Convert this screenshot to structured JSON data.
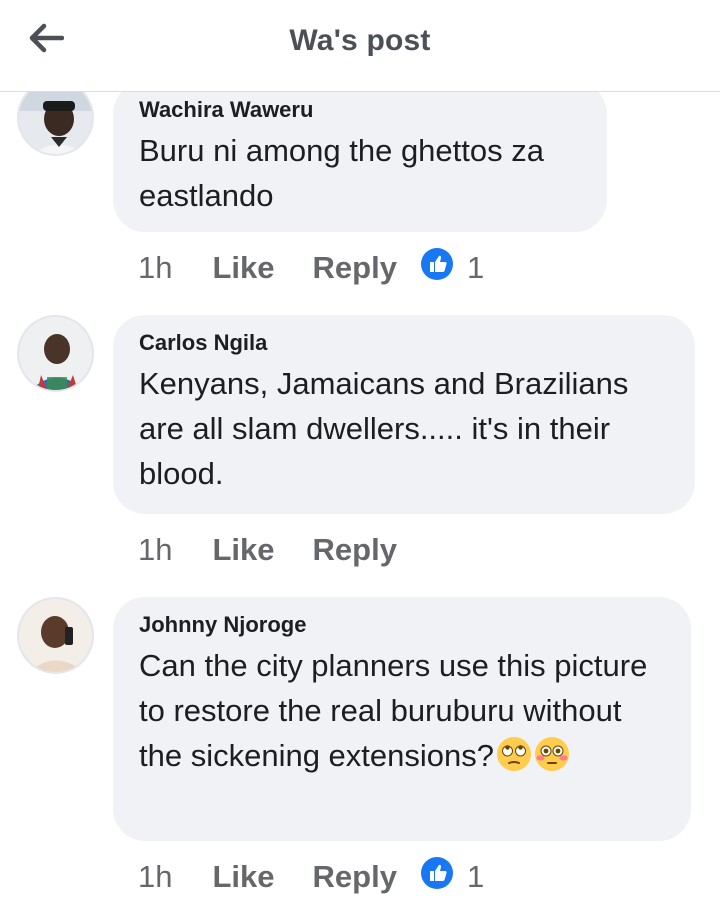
{
  "header": {
    "title": "Wa's post",
    "back_icon": "arrow-left-icon"
  },
  "comments": [
    {
      "author": "Wachira Waweru",
      "text": "Buru ni among the ghettos za eastlando",
      "time": "1h",
      "like_label": "Like",
      "reply_label": "Reply",
      "reaction_count": "1",
      "reaction_icon": "thumbs-up-icon"
    },
    {
      "author": "Carlos Ngila",
      "text": "Kenyans, Jamaicans and Brazilians are all slam dwellers..... it's in their blood.",
      "time": "1h",
      "like_label": "Like",
      "reply_label": "Reply"
    },
    {
      "author": "Johnny Njoroge",
      "text": "Can the city planners use this picture to restore the real buruburu without the sickening extensions?",
      "emojis": [
        "eye-roll-emoji",
        "flushed-emoji"
      ],
      "time": "1h",
      "like_label": "Like",
      "reply_label": "Reply",
      "reaction_count": "1",
      "reaction_icon": "thumbs-up-icon"
    }
  ],
  "colors": {
    "bubble": "#f0f2f5",
    "secondary_text": "#65676b",
    "like_blue": "#1877f2"
  }
}
